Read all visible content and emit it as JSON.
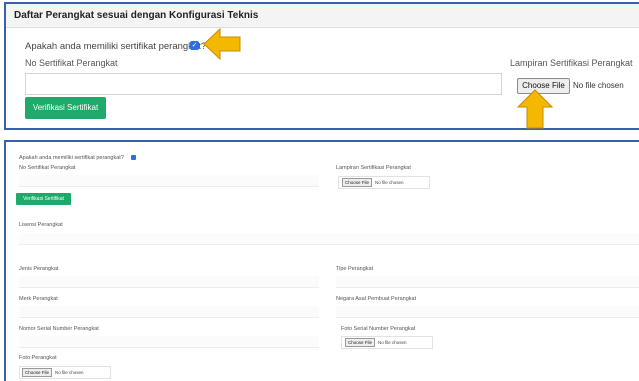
{
  "panel1": {
    "title": "Daftar Perangkat sesuai dengan Konfigurasi Teknis",
    "question": "Apakah anda memiliki sertifikat perangkat?",
    "checkbox_checked": true,
    "no_sertifikat_label": "No Sertifikat Perangkat",
    "no_sertifikat_value": "",
    "lampiran_label": "Lampiran Sertifikasi Perangkat",
    "choose_file": "Choose File",
    "file_status": "No file chosen",
    "verify_button": "Verifikasi Sertifikat"
  },
  "panel2": {
    "question": "Apakah anda memiliki sertifikat perangkat?",
    "checkbox_checked": true,
    "no_sertifikat_label": "No Sertifikat Perangkat",
    "lampiran_label": "Lampiran Sertifikasi Perangkat",
    "choose_file": "Choose File",
    "file_status": "No file chosen",
    "verify_button": "Verifikasi Sertifikat",
    "lisensi_label": "Lisensi Perangkat",
    "jenis_label": "Jenis Perangkat",
    "tipe_label": "Tipe Perangkat",
    "merk_label": "Merk Perangkat",
    "negara_label": "Negara Asal Pembuat Perangkat",
    "serial_label": "Nomor Serial Number Perangkat",
    "foto_serial_label": "Foto Serial Number Perangkat",
    "foto_label": "Foto Perangkat"
  },
  "colors": {
    "accent_green": "#1fa96b",
    "border_blue": "#3a5fb0",
    "arrow_fill": "#f5b800",
    "checkbox_blue": "#2f6fd6"
  }
}
